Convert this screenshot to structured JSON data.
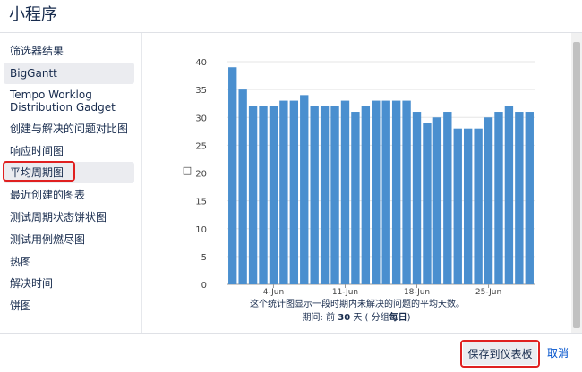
{
  "header": {
    "title": "小程序"
  },
  "sidebar": {
    "items": [
      {
        "label": "筛选器结果"
      },
      {
        "label": "BigGantt"
      },
      {
        "label": "Tempo Worklog Distribution Gadget"
      },
      {
        "label": "创建与解决的问题对比图"
      },
      {
        "label": "响应时间图"
      },
      {
        "label": "平均周期图"
      },
      {
        "label": "最近创建的图表"
      },
      {
        "label": "测试周期状态饼状图"
      },
      {
        "label": "测试用例燃尽图"
      },
      {
        "label": "热图"
      },
      {
        "label": "解决时间"
      },
      {
        "label": "饼图"
      }
    ]
  },
  "chart_data": {
    "type": "bar",
    "y_ticks": [
      0,
      5,
      10,
      15,
      20,
      25,
      30,
      35,
      40
    ],
    "ylim": [
      0,
      40
    ],
    "ylabel": "□",
    "x_ticks": [
      "4-Jun",
      "11-Jun",
      "18-Jun",
      "25-Jun"
    ],
    "values": [
      39,
      35,
      32,
      32,
      32,
      33,
      33,
      34,
      32,
      32,
      32,
      33,
      31,
      32,
      33,
      33,
      33,
      33,
      31,
      29,
      30,
      31,
      28,
      28,
      28,
      30,
      31,
      32,
      31,
      31
    ],
    "bar_color": "#4a8fcf",
    "caption": "这个统计图显示一段时期内未解决的问题的平均天数。",
    "period_prefix": "期间: 前 ",
    "period_days": "30",
    "period_mid": " 天 ( 分组",
    "period_group": "每日",
    "period_suffix": ")"
  },
  "footer": {
    "save_label": "保存到仪表板",
    "cancel_label": "取消"
  }
}
